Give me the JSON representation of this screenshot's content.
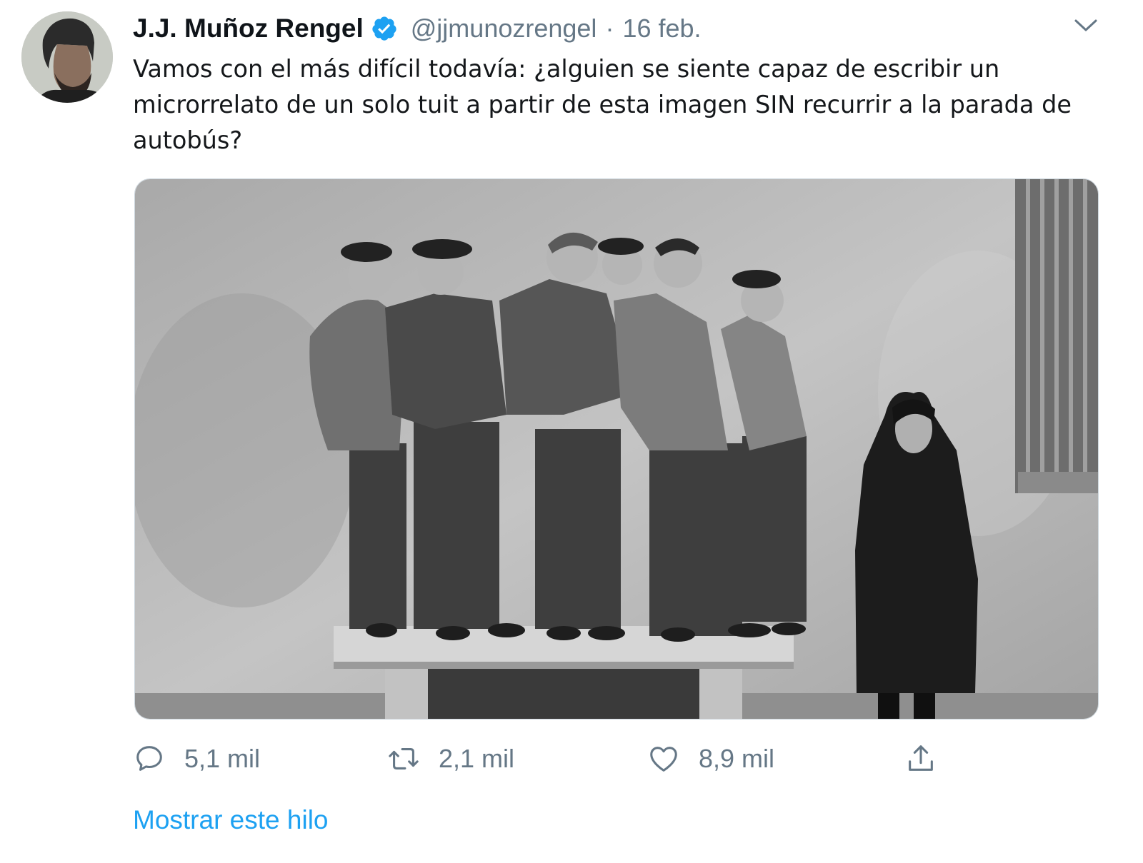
{
  "tweet": {
    "author_name": "J.J. Muñoz Rengel",
    "handle": "@jjmunozrengel",
    "separator": "·",
    "date": "16 feb.",
    "text": "Vamos con el más difícil todavía: ¿alguien se siente capaz de escribir un microrrelato de un solo tuit a partir de esta imagen SIN recurrir a la parada de autobús?"
  },
  "actions": {
    "reply": {
      "icon": "reply-icon",
      "count": "5,1 mil"
    },
    "retweet": {
      "icon": "retweet-icon",
      "count": "2,1 mil"
    },
    "like": {
      "icon": "heart-icon",
      "count": "8,9 mil"
    },
    "share": {
      "icon": "share-icon"
    }
  },
  "thread_link": "Mostrar este hilo",
  "colors": {
    "link": "#1da1f2",
    "muted": "#657786",
    "verified": "#1da1f2",
    "text": "#14171a"
  }
}
